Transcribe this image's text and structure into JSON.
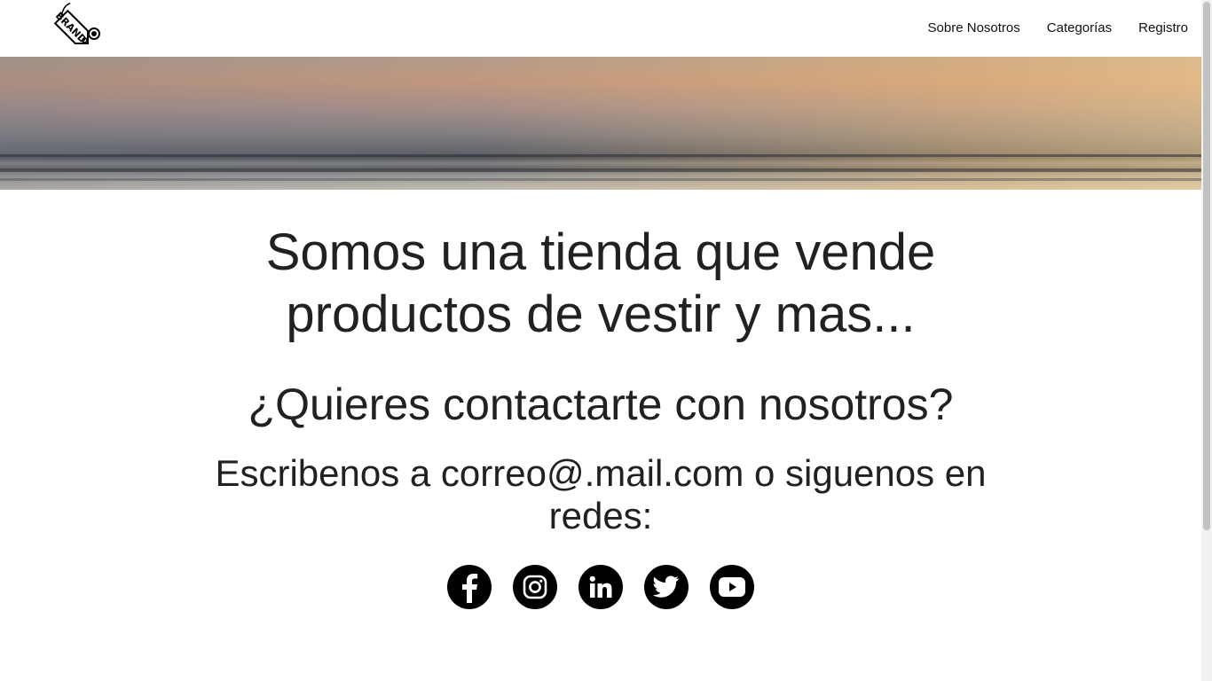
{
  "header": {
    "logo_text": "BRAND",
    "nav": [
      {
        "label": "Sobre Nosotros"
      },
      {
        "label": "Categorías"
      },
      {
        "label": "Registro"
      }
    ]
  },
  "hero": {
    "description": ""
  },
  "main": {
    "headline": "Somos una tienda que vende productos de vestir y mas...",
    "subheadline": "¿Quieres contactarte con nosotros?",
    "contact_text": "Escribenos a correo@.mail.com o siguenos en redes:"
  },
  "socials": [
    {
      "icon": "facebook-icon"
    },
    {
      "icon": "instagram-icon"
    },
    {
      "icon": "linkedin-icon"
    },
    {
      "icon": "twitter-icon"
    },
    {
      "icon": "youtube-icon"
    }
  ],
  "colors": {
    "text": "#212121",
    "social_bg": "#000000",
    "background": "#ffffff"
  }
}
